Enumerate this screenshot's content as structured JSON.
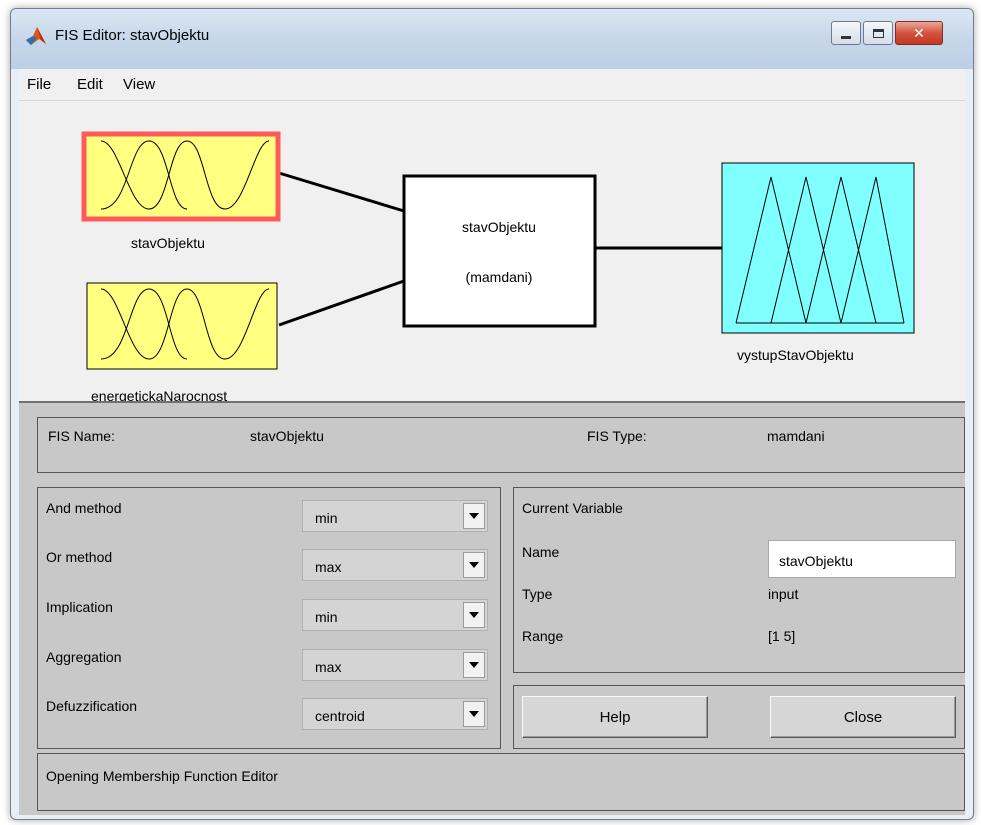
{
  "window": {
    "title": "FIS Editor: stavObjektu",
    "close_glyph": "✕"
  },
  "menu": {
    "file": "File",
    "edit": "Edit",
    "view": "View"
  },
  "diagram": {
    "inputs": [
      {
        "name": "stavObjektu",
        "selected": true,
        "color": "#ffff80"
      },
      {
        "name": "energetickaNarocnost",
        "selected": false,
        "color": "#ffff80"
      }
    ],
    "system": {
      "name": "stavObjektu",
      "type": "(mamdani)"
    },
    "output": {
      "name": "vystupStavObjektu",
      "color": "#80ffff"
    },
    "selection_color": "#ff5a5a"
  },
  "fis_info": {
    "name_label": "FIS Name:",
    "name_value": "stavObjektu",
    "type_label": "FIS Type:",
    "type_value": "mamdani"
  },
  "methods": [
    {
      "label": "And method",
      "value": "min"
    },
    {
      "label": "Or method",
      "value": "max"
    },
    {
      "label": "Implication",
      "value": "min"
    },
    {
      "label": "Aggregation",
      "value": "max"
    },
    {
      "label": "Defuzzification",
      "value": "centroid"
    }
  ],
  "current_variable": {
    "heading": "Current Variable",
    "name_label": "Name",
    "name_value": "stavObjektu",
    "type_label": "Type",
    "type_value": "input",
    "range_label": "Range",
    "range_value": "[1 5]"
  },
  "buttons": {
    "help": "Help",
    "close": "Close"
  },
  "status": {
    "message": "Opening Membership Function Editor"
  }
}
